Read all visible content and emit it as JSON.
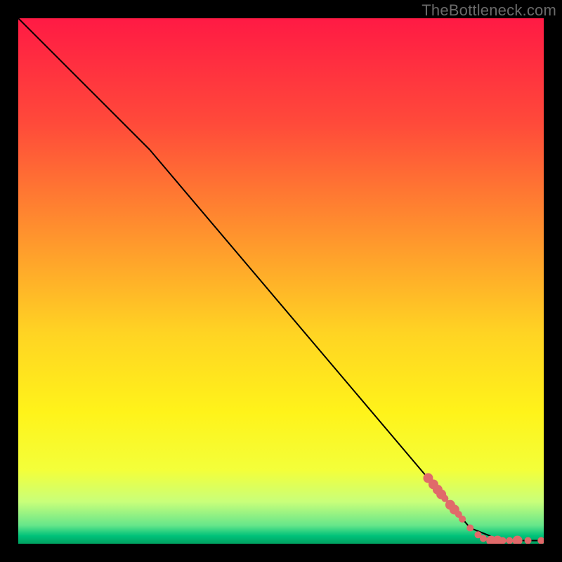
{
  "watermark": "TheBottleneck.com",
  "chart_data": {
    "type": "line",
    "title": "",
    "xlabel": "",
    "ylabel": "",
    "xlim": [
      0,
      100
    ],
    "ylim": [
      0,
      100
    ],
    "grid": false,
    "legend": false,
    "background_gradient": {
      "stops": [
        {
          "offset": 0.0,
          "color": "#ff1a44"
        },
        {
          "offset": 0.2,
          "color": "#ff4a3a"
        },
        {
          "offset": 0.4,
          "color": "#ff8f2e"
        },
        {
          "offset": 0.6,
          "color": "#ffd423"
        },
        {
          "offset": 0.75,
          "color": "#fff31a"
        },
        {
          "offset": 0.86,
          "color": "#f3ff3a"
        },
        {
          "offset": 0.92,
          "color": "#c9ff7a"
        },
        {
          "offset": 0.965,
          "color": "#66e68a"
        },
        {
          "offset": 0.985,
          "color": "#00c27a"
        },
        {
          "offset": 1.0,
          "color": "#00a060"
        }
      ]
    },
    "series": [
      {
        "name": "curve",
        "type": "line",
        "color": "#000000",
        "width": 2,
        "points": [
          {
            "x": 0,
            "y": 100
          },
          {
            "x": 25,
            "y": 75
          },
          {
            "x": 86,
            "y": 3
          },
          {
            "x": 92,
            "y": 0.6
          },
          {
            "x": 100,
            "y": 0.6
          }
        ]
      },
      {
        "name": "markers",
        "type": "scatter",
        "color": "#e06a6a",
        "radius_small": 5,
        "radius_large": 7,
        "points": [
          {
            "x": 78.0,
            "y": 12.5,
            "r": "large"
          },
          {
            "x": 79.0,
            "y": 11.3,
            "r": "large"
          },
          {
            "x": 79.8,
            "y": 10.3,
            "r": "large"
          },
          {
            "x": 80.5,
            "y": 9.4,
            "r": "large"
          },
          {
            "x": 81.2,
            "y": 8.6,
            "r": "small"
          },
          {
            "x": 82.2,
            "y": 7.4,
            "r": "large"
          },
          {
            "x": 83.0,
            "y": 6.5,
            "r": "large"
          },
          {
            "x": 83.8,
            "y": 5.6,
            "r": "small"
          },
          {
            "x": 84.5,
            "y": 4.7,
            "r": "small"
          },
          {
            "x": 86.0,
            "y": 3.0,
            "r": "small"
          },
          {
            "x": 87.5,
            "y": 1.7,
            "r": "small"
          },
          {
            "x": 88.5,
            "y": 1.0,
            "r": "small"
          },
          {
            "x": 90.0,
            "y": 0.6,
            "r": "large"
          },
          {
            "x": 91.2,
            "y": 0.6,
            "r": "large"
          },
          {
            "x": 92.2,
            "y": 0.6,
            "r": "small"
          },
          {
            "x": 93.5,
            "y": 0.6,
            "r": "small"
          },
          {
            "x": 95.0,
            "y": 0.6,
            "r": "large"
          },
          {
            "x": 97.0,
            "y": 0.6,
            "r": "small"
          },
          {
            "x": 99.5,
            "y": 0.6,
            "r": "small"
          }
        ]
      }
    ]
  }
}
